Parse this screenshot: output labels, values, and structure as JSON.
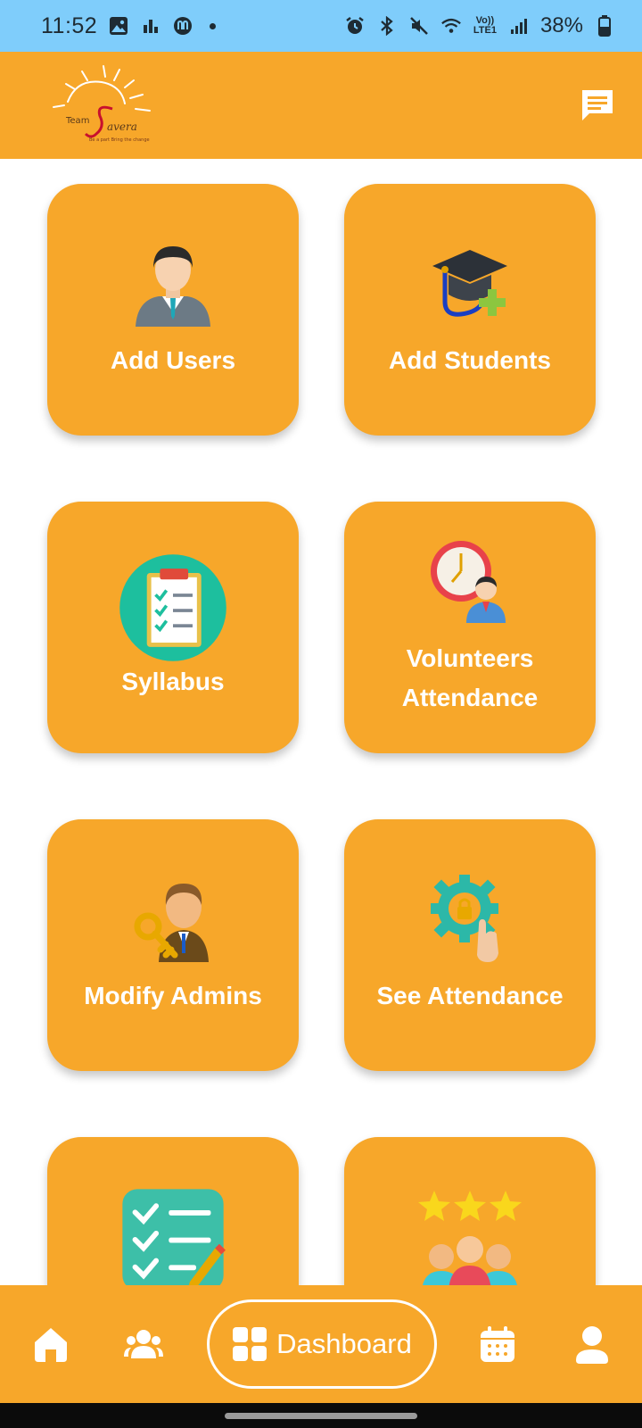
{
  "status_bar": {
    "time": "11:52",
    "battery_percent": "38%",
    "network_label": "Vo)) LTE1",
    "left_icons": [
      "gallery-icon",
      "chart-icon",
      "app-icon"
    ],
    "right_icons": [
      "alarm-icon",
      "bluetooth-icon",
      "mute-icon",
      "wifi-icon",
      "signal-icon",
      "battery-icon"
    ]
  },
  "header": {
    "logo_text": "Team Savera",
    "logo_tagline": "Be a part Bring the change",
    "chat_icon": "chat-icon"
  },
  "colors": {
    "primary": "#f7a72a",
    "status_bar": "#7fcdfb",
    "text_on_primary": "#ffffff"
  },
  "tiles": [
    {
      "label": "Add Users",
      "icon": "user-icon"
    },
    {
      "label": "Add Students",
      "icon": "graduation-cap-plus-icon"
    },
    {
      "label": "Syllabus",
      "icon": "checklist-clipboard-icon"
    },
    {
      "label": "Volunteers Attendance",
      "icon": "clock-person-icon"
    },
    {
      "label": "Modify Admins",
      "icon": "admin-key-icon"
    },
    {
      "label": "See Attendance",
      "icon": "gear-lock-icon"
    },
    {
      "label": "",
      "icon": "task-list-icon"
    },
    {
      "label": "",
      "icon": "rating-group-icon"
    }
  ],
  "bottom_nav": {
    "items": [
      "home-icon",
      "group-icon",
      "calendar-icon",
      "profile-icon"
    ],
    "active_label": "Dashboard",
    "active_icon": "dashboard-grid-icon"
  }
}
